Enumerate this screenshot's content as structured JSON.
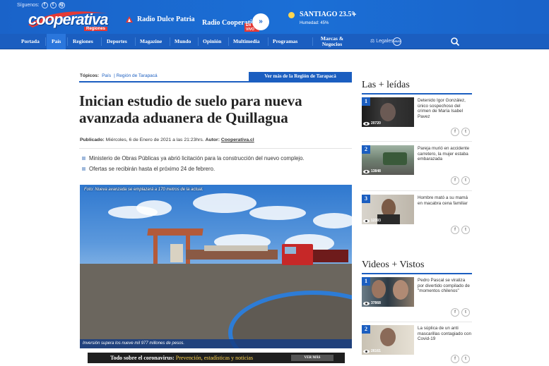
{
  "header": {
    "follow_label": "Síguenos:",
    "social": [
      "f",
      "t",
      "ig"
    ],
    "logo": "cooperativa",
    "logo_sub": "Regiones",
    "radio1": "Radio Dulce Patria",
    "radio2": "Radio Cooperativa",
    "radio2_sub": "EN VIVO",
    "play_icon": "»",
    "weather_city": "SANTIAGO 23.5°",
    "weather_humidity": "Humedad: 45%",
    "weather_plus": "+"
  },
  "nav": {
    "items": [
      "Portada",
      "País",
      "Regiones",
      "Deportes",
      "Magazine",
      "Mundo",
      "Opinión",
      "Multimedia",
      "Programas"
    ],
    "marcas_line1": "Marcas &",
    "marcas_line2": "Negocios",
    "legales": "Legales",
    "vivo": "VIVO"
  },
  "article": {
    "topics_label": "Tópicos:",
    "topic1": "País",
    "topic2": "| Región de Tarapacá",
    "more_region": "Ver más de la Región de Tarapacá",
    "title": "Inician estudio de suelo para nueva avanzada aduanera de Quillagua",
    "byline_prefix": "Publicado:",
    "byline_date": "Miércoles, 6 de Enero de 2021 a las 21:23hrs.",
    "byline_author_label": "Autor:",
    "byline_author": "Cooperativa.cl",
    "bullets": [
      "Ministerio de Obras Públicas ya abrió licitación para la construcción del nuevo complejo.",
      "Ofertas se recibirán hasta el próximo 24 de febrero."
    ],
    "photo_caption_top": "Foto: Nueva avanzada se emplazará a 170 metros de la actual.",
    "photo_caption_bottom": "Inversión supera los nueve mil 977 millones de pesos."
  },
  "covid": {
    "lead": "Todo sobre el coronavirus:",
    "topics": "Prevención, estadísticas y noticias",
    "button": "VER MÁS"
  },
  "sidebar": {
    "most_read_title": "Las + leídas",
    "most_read": [
      {
        "rank": "1",
        "title": "Detenido Igor González, único sospechoso del crimen de María Isabel Pavez",
        "views": "20720"
      },
      {
        "rank": "2",
        "title": "Pareja murió en accidente carretero, la mujer estaba embarazada",
        "views": "13848"
      },
      {
        "rank": "3",
        "title": "Hombre mató a su mamá en macabra cena familiar",
        "views": "12393"
      }
    ],
    "videos_title": "Videos + Vistos",
    "videos": [
      {
        "rank": "1",
        "title": "Pedro Pascal se viraliza por divertido compilado de \"momentos chilenos\"",
        "views": "37868"
      },
      {
        "rank": "2",
        "title": "La súplica de un anti mascarillas contagiado con Covid-19",
        "views": "26161"
      }
    ],
    "share_f": "f",
    "share_t": "t"
  }
}
